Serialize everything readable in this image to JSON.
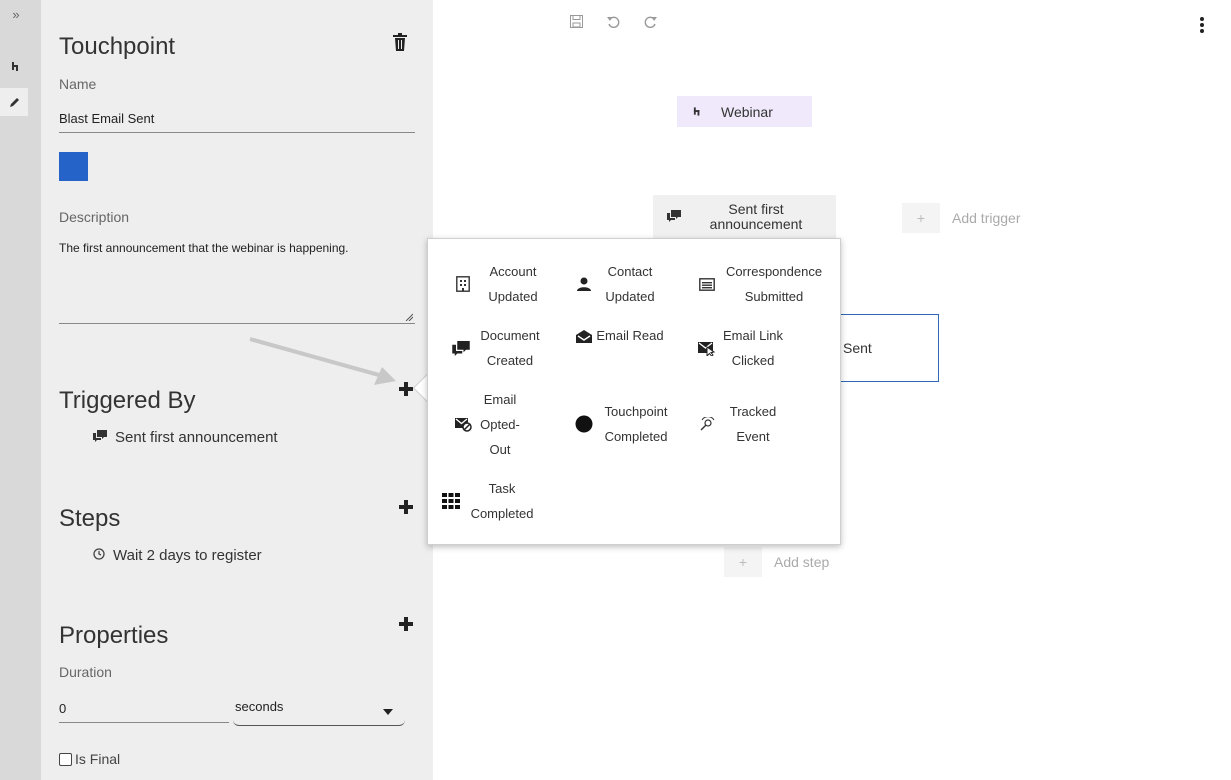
{
  "rail": {
    "expand_icon": "double-chevron-right-icon",
    "items": [
      {
        "name": "trigger-icon"
      },
      {
        "name": "pencil-icon",
        "active": true
      }
    ]
  },
  "panel": {
    "title": "Touchpoint",
    "name_label": "Name",
    "name_value": "Blast Email Sent",
    "color_swatch": "#2563c9",
    "description_label": "Description",
    "description_value": "The first announcement that the webinar is happening.",
    "triggered_by_title": "Triggered By",
    "triggered_by_items": [
      "Sent first announcement"
    ],
    "steps_title": "Steps",
    "steps_items": [
      "Wait 2 days to register"
    ],
    "properties_title": "Properties",
    "duration_label": "Duration",
    "duration_value": "0",
    "duration_unit": "seconds",
    "is_final_label": "Is Final"
  },
  "canvas": {
    "webinar_node": "Webinar",
    "trigger_node": "Sent first announcement",
    "add_trigger": "Add trigger",
    "touchpoint_node_partial": "Sent",
    "add_step": "Add step",
    "add_symbol": "+"
  },
  "popup": {
    "options": [
      {
        "label": "Account Updated",
        "icon": "building-icon"
      },
      {
        "label": "Contact Updated",
        "icon": "person-icon"
      },
      {
        "label": "Correspondence Submitted",
        "icon": "form-icon"
      },
      {
        "label": "Document Created",
        "icon": "comments-icon"
      },
      {
        "label": "Email Read",
        "icon": "open-envelope-icon"
      },
      {
        "label": "Email Link Clicked",
        "icon": "envelope-cursor-icon"
      },
      {
        "label": "Email Opted-Out",
        "icon": "envelope-block-icon"
      },
      {
        "label": "Touchpoint Completed",
        "icon": "filled-circle-icon"
      },
      {
        "label": "Tracked Event",
        "icon": "tracking-icon"
      },
      {
        "label": "Task Completed",
        "icon": "grid-icon"
      }
    ]
  },
  "colors": {
    "accent_blue": "#2563c9",
    "node_purple": "#efe9fb",
    "node_border_blue": "#2f67b6",
    "panel_bg": "#eeeeee",
    "rail_bg": "#d9d9d9"
  }
}
